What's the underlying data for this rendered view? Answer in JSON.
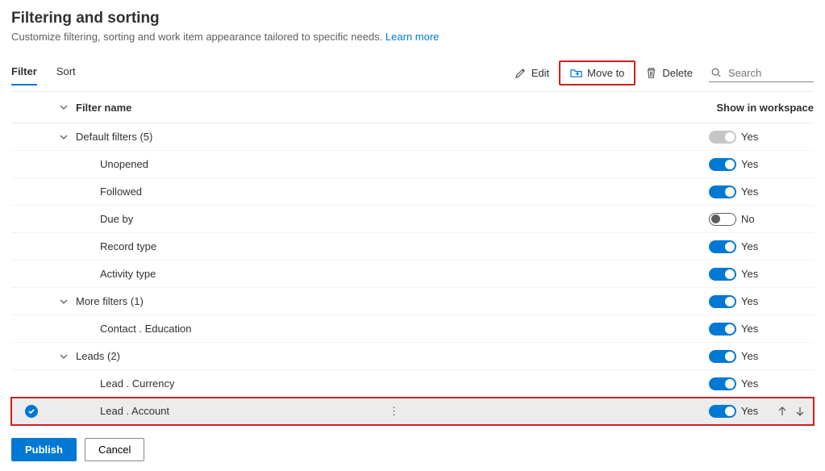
{
  "header": {
    "title": "Filtering and sorting",
    "subtitle": "Customize filtering, sorting and work item appearance tailored to specific needs.",
    "learnMore": "Learn more"
  },
  "tabs": {
    "filter": "Filter",
    "sort": "Sort"
  },
  "toolbar": {
    "edit": "Edit",
    "moveTo": "Move to",
    "delete": "Delete",
    "searchPlaceholder": "Search"
  },
  "columns": {
    "filterName": "Filter name",
    "showInWorkspace": "Show in workspace"
  },
  "toggleLabels": {
    "yes": "Yes",
    "no": "No"
  },
  "rows": [
    {
      "type": "group",
      "label": "Default filters (5)",
      "toggle": "disabled"
    },
    {
      "type": "leaf",
      "label": "Unopened",
      "toggle": "on"
    },
    {
      "type": "leaf",
      "label": "Followed",
      "toggle": "on"
    },
    {
      "type": "leaf",
      "label": "Due by",
      "toggle": "off"
    },
    {
      "type": "leaf",
      "label": "Record type",
      "toggle": "on"
    },
    {
      "type": "leaf",
      "label": "Activity type",
      "toggle": "on"
    },
    {
      "type": "group",
      "label": "More filters (1)",
      "toggle": "on"
    },
    {
      "type": "leaf",
      "label": "Contact . Education",
      "toggle": "on"
    },
    {
      "type": "group",
      "label": "Leads (2)",
      "toggle": "on"
    },
    {
      "type": "leaf",
      "label": "Lead . Currency",
      "toggle": "on"
    },
    {
      "type": "leaf",
      "label": "Lead . Account",
      "toggle": "on",
      "selected": true,
      "showArrows": true
    }
  ],
  "footer": {
    "publish": "Publish",
    "cancel": "Cancel"
  }
}
